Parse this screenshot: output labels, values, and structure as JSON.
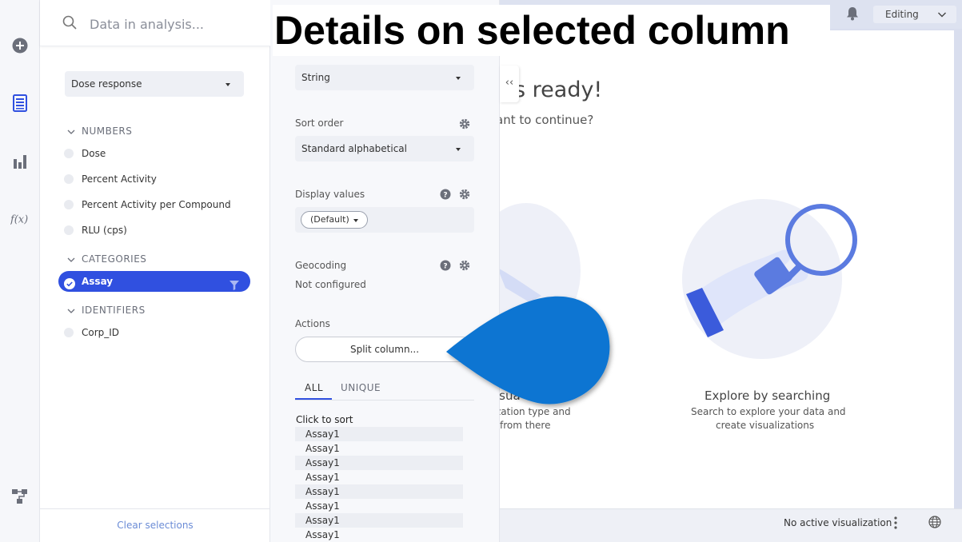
{
  "annotation": {
    "title": "Details on selected column"
  },
  "rail": {
    "icons": [
      "add-icon",
      "data-icon",
      "visualization-icon",
      "function-icon",
      "data-canvas-icon"
    ]
  },
  "data_panel": {
    "search_placeholder": "Data in analysis...",
    "table_select": "Dose response",
    "groups": [
      {
        "label": "NUMBERS",
        "items": [
          "Dose",
          "Percent Activity",
          "Percent Activity per Compound",
          "RLU (cps)"
        ]
      },
      {
        "label": "CATEGORIES",
        "items": [
          "Assay"
        ]
      },
      {
        "label": "IDENTIFIERS",
        "items": [
          "Corp_ID"
        ]
      }
    ],
    "selected_item": "Assay",
    "clear_selections": "Clear selections"
  },
  "details": {
    "data_type": "String",
    "sort_order_label": "Sort order",
    "sort_order_value": "Standard alphabetical",
    "display_values_label": "Display values",
    "display_values_value": "(Default)",
    "geocoding_label": "Geocoding",
    "geocoding_value": "Not configured",
    "actions_label": "Actions",
    "split_column": "Split column...",
    "tabs": [
      "ALL",
      "UNIQUE"
    ],
    "active_tab": "ALL",
    "sort_hint": "Click to sort",
    "values": [
      "Assay1",
      "Assay1",
      "Assay1",
      "Assay1",
      "Assay1",
      "Assay1",
      "Assay1",
      "Assay1"
    ]
  },
  "canvas": {
    "editing": "Editing",
    "ready_title": "s ready!",
    "ready_sub": "ant to continue?",
    "left_card_title": "isua",
    "left_card_desc_1": "zation type and",
    "left_card_desc_2": "from there",
    "right_card_title": "Explore by searching",
    "right_card_desc_1": "Search to explore your data and",
    "right_card_desc_2": "create visualizations",
    "status": "No active visualization",
    "collapse": "‹‹"
  },
  "colors": {
    "accent": "#3050e0",
    "callout": "#0a75d2"
  }
}
